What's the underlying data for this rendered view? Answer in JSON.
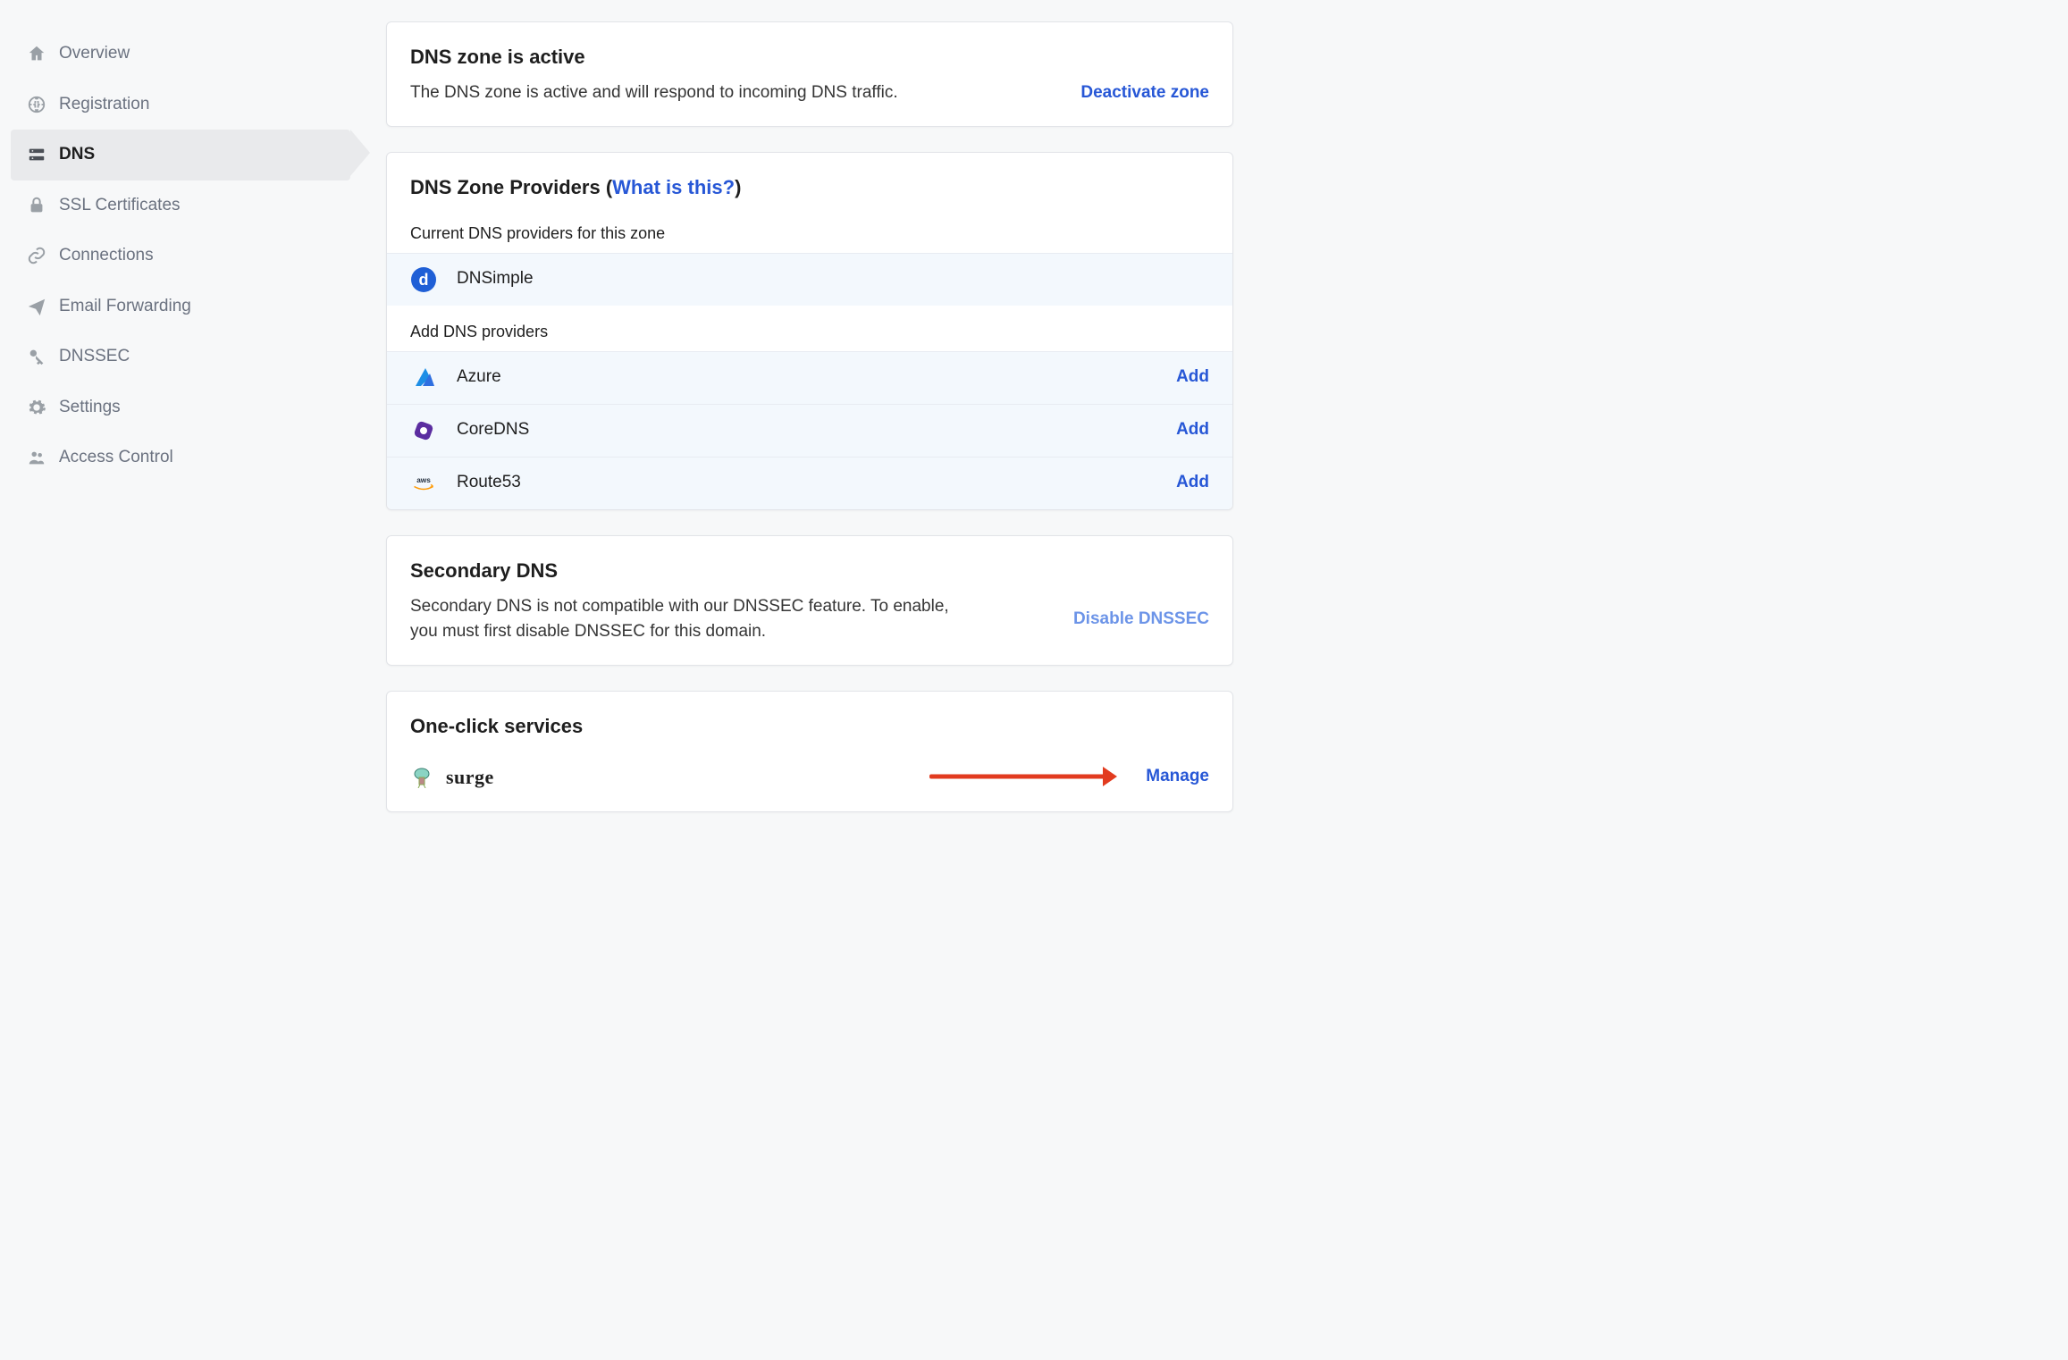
{
  "sidebar": {
    "items": [
      {
        "label": "Overview"
      },
      {
        "label": "Registration"
      },
      {
        "label": "DNS"
      },
      {
        "label": "SSL Certificates"
      },
      {
        "label": "Connections"
      },
      {
        "label": "Email Forwarding"
      },
      {
        "label": "DNSSEC"
      },
      {
        "label": "Settings"
      },
      {
        "label": "Access Control"
      }
    ]
  },
  "zone": {
    "title": "DNS zone is active",
    "desc": "The DNS zone is active and will respond to incoming DNS traffic.",
    "action": "Deactivate zone"
  },
  "providers": {
    "title_prefix": "DNS Zone Providers ",
    "paren_open": "(",
    "what_link": "What is this?",
    "paren_close": ")",
    "current_label": "Current DNS providers for this zone",
    "current": [
      {
        "name": "DNSimple"
      }
    ],
    "add_label": "Add DNS providers",
    "addable": [
      {
        "name": "Azure",
        "action": "Add"
      },
      {
        "name": "CoreDNS",
        "action": "Add"
      },
      {
        "name": "Route53",
        "action": "Add"
      }
    ]
  },
  "secondary": {
    "title": "Secondary DNS",
    "desc": "Secondary DNS is not compatible with our DNSSEC feature. To enable, you must first disable DNSSEC for this domain.",
    "action": "Disable DNSSEC"
  },
  "oneclick": {
    "title": "One-click services",
    "services": [
      {
        "name": "surge",
        "action": "Manage"
      }
    ]
  }
}
